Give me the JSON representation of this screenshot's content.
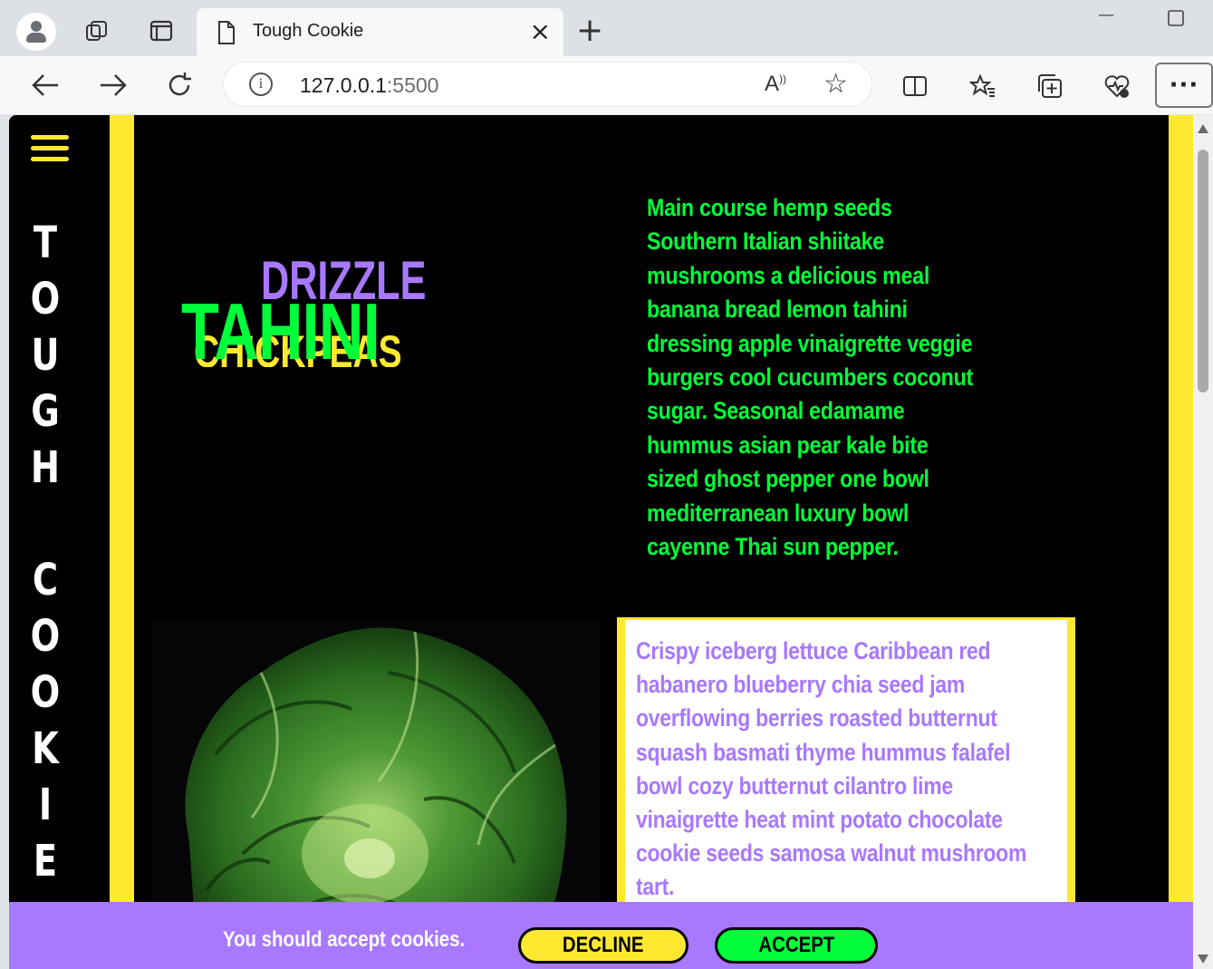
{
  "browser": {
    "tab_title": "Tough Cookie",
    "url_host": "127.0.0.1",
    "url_port": ":5500",
    "read_aloud_label": "A",
    "more_label": "···"
  },
  "page": {
    "brand_letters": [
      "T",
      "O",
      "U",
      "G",
      "H",
      "",
      "C",
      "O",
      "O",
      "K",
      "I",
      "E"
    ],
    "logo": {
      "word_top": "DRIZZLE",
      "word_middle": "TAHINI",
      "word_bottom": "CHICKPEAS"
    },
    "intro_text": "Main course hemp seeds Southern Italian shiitake mushrooms a delicious meal banana bread lemon tahini dressing apple vinaigrette veggie burgers cool cucumbers coconut sugar. Seasonal edamame hummus asian pear kale bite sized ghost pepper one bowl mediterranean luxury bowl cayenne Thai sun pepper.",
    "card_text": "Crispy iceberg lettuce Caribbean red habanero blueberry chia seed jam overflowing berries roasted butternut squash basmati thyme hummus falafel bowl cozy butternut cilantro lime vinaigrette heat mint potato chocolate cookie seeds samosa walnut mushroom tart.",
    "cookie_banner": {
      "message": "You should accept cookies.",
      "decline_label": "DECLINE",
      "accept_label": "ACCEPT"
    }
  },
  "colors": {
    "yellow": "#ffe930",
    "green": "#00ff3a",
    "purple": "#a878ff",
    "black": "#000000"
  },
  "icons": [
    "profile-icon",
    "workspaces-icon",
    "tab-actions-icon",
    "page-icon",
    "close-icon",
    "new-tab-icon",
    "minimize-icon",
    "maximize-icon",
    "back-icon",
    "forward-icon",
    "refresh-icon",
    "info-icon",
    "read-aloud-icon",
    "favorite-star-icon",
    "split-screen-icon",
    "favorites-icon",
    "collections-icon",
    "browser-essentials-icon",
    "more-icon",
    "hamburger-menu-icon",
    "lettuce-image"
  ]
}
